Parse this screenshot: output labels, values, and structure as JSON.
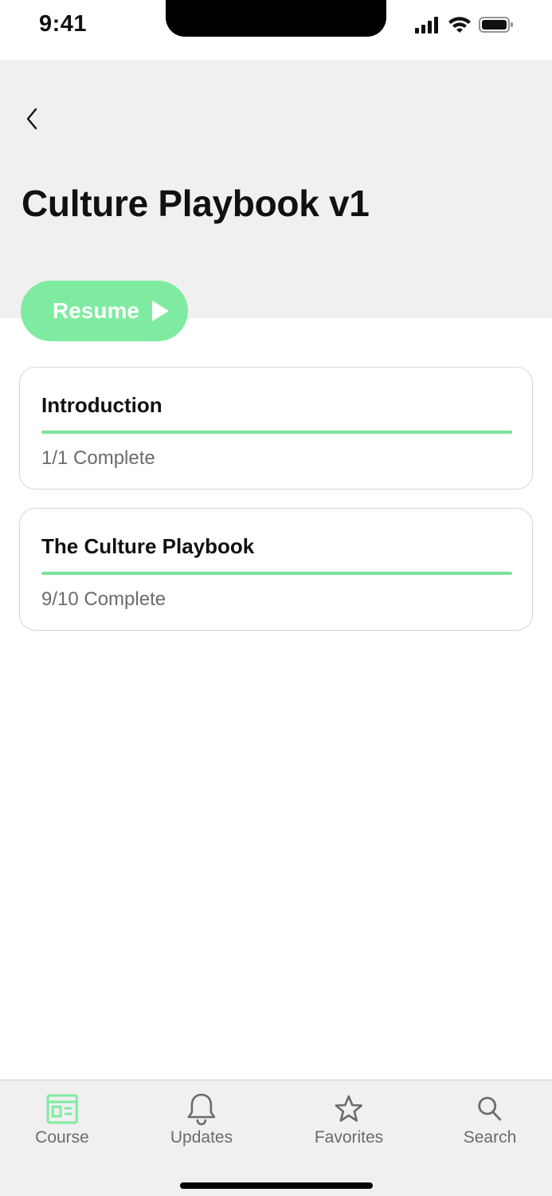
{
  "status_bar": {
    "time": "9:41"
  },
  "header": {
    "title": "Culture Playbook v1"
  },
  "resume": {
    "label": "Resume"
  },
  "modules": [
    {
      "title": "Introduction",
      "status": "1/1 Complete",
      "progress": 1.0
    },
    {
      "title": "The Culture Playbook",
      "status": "9/10 Complete",
      "progress": 1.0
    }
  ],
  "tabs": [
    {
      "label": "Course",
      "icon": "course-icon",
      "active": true
    },
    {
      "label": "Updates",
      "icon": "bell-icon",
      "active": false
    },
    {
      "label": "Favorites",
      "icon": "star-icon",
      "active": false
    },
    {
      "label": "Search",
      "icon": "search-icon",
      "active": false
    }
  ],
  "colors": {
    "accent": "#7eeba1",
    "header_bg": "#f0f0f0",
    "muted_text": "#6b6b6b"
  }
}
